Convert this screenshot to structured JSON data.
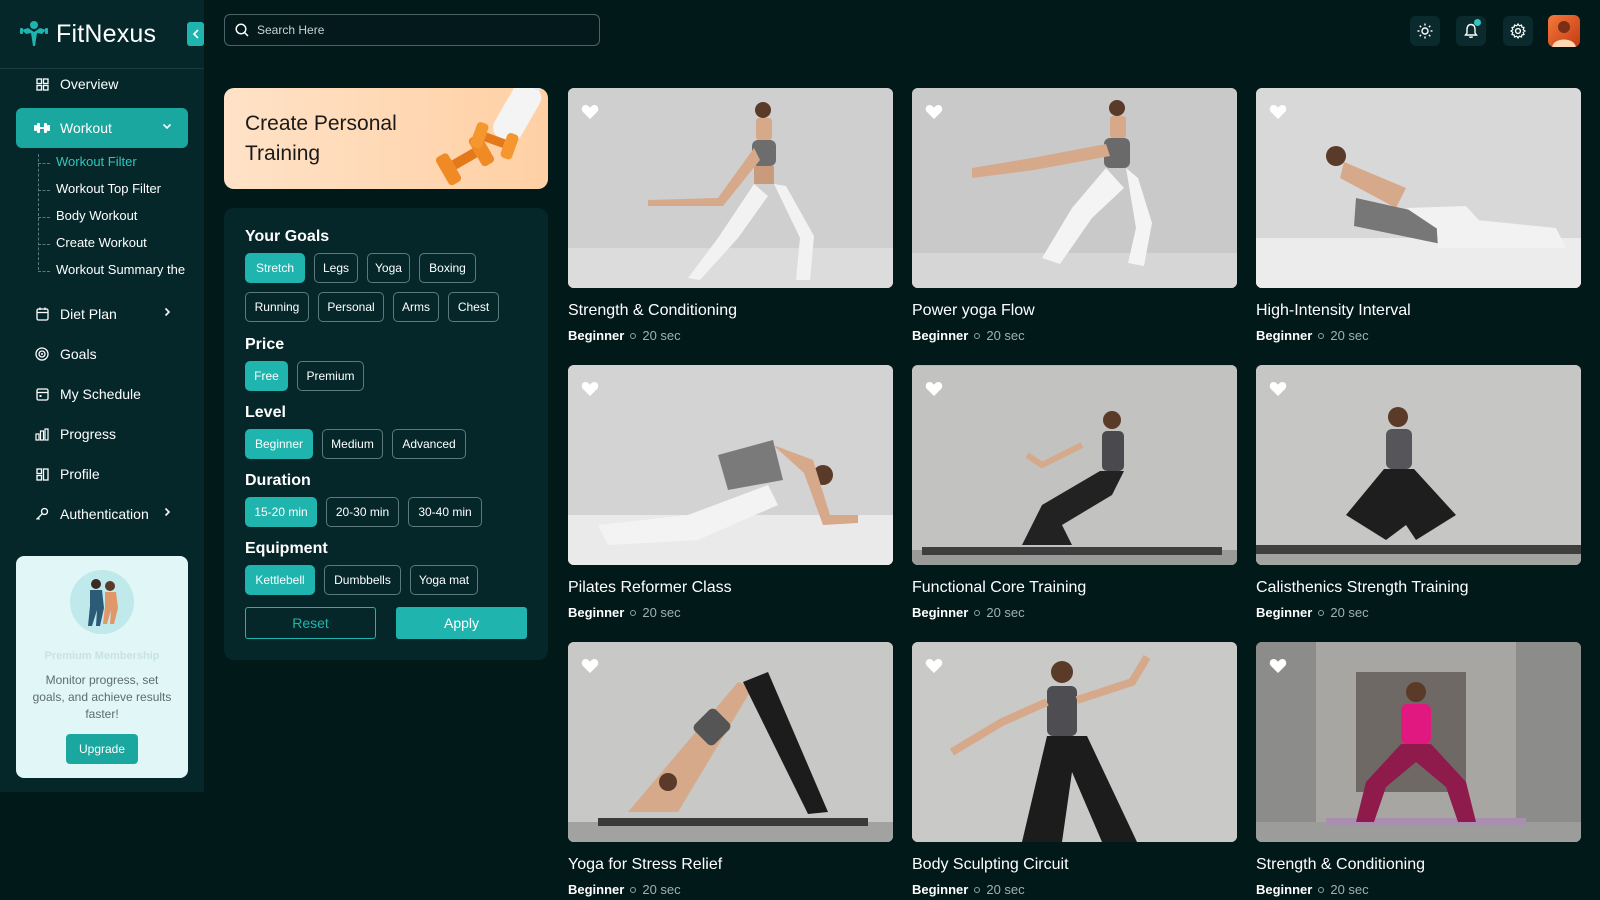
{
  "app": {
    "name": "FitNexus"
  },
  "search": {
    "placeholder": "Search Here"
  },
  "sidebar": {
    "items": [
      {
        "label": "Overview",
        "icon": "dashboard-icon"
      },
      {
        "label": "Workout",
        "icon": "dumbbell-icon",
        "active": true,
        "expanded": true
      },
      {
        "label": "Diet Plan",
        "icon": "calendar-icon"
      },
      {
        "label": "Goals",
        "icon": "target-icon"
      },
      {
        "label": "My Schedule",
        "icon": "schedule-icon"
      },
      {
        "label": "Progress",
        "icon": "bar-chart-icon"
      },
      {
        "label": "Profile",
        "icon": "profile-grid-icon"
      },
      {
        "label": "Authentication",
        "icon": "key-icon"
      }
    ],
    "submenu": [
      {
        "label": "Workout Filter",
        "active": true
      },
      {
        "label": "Workout Top Filter"
      },
      {
        "label": "Body Workout"
      },
      {
        "label": "Create Workout"
      },
      {
        "label": "Workout Summary"
      }
    ]
  },
  "promo": {
    "title": "Premium Membership",
    "text": "Monitor progress, set goals, and achieve results faster!",
    "button": "Upgrade"
  },
  "banner": {
    "title": "Create Personal Training"
  },
  "filters": {
    "goals": {
      "title": "Your Goals",
      "options": [
        "Stretch",
        "Legs",
        "Yoga",
        "Boxing",
        "Running",
        "Personal",
        "Arms",
        "Chest"
      ],
      "selected": "Stretch"
    },
    "price": {
      "title": "Price",
      "options": [
        "Free",
        "Premium"
      ],
      "selected": "Free"
    },
    "level": {
      "title": "Level",
      "options": [
        "Beginner",
        "Medium",
        "Advanced"
      ],
      "selected": "Beginner"
    },
    "duration": {
      "title": "Duration",
      "options": [
        "15-20 min",
        "20-30 min",
        "30-40 min"
      ],
      "selected": "15-20 min"
    },
    "equipment": {
      "title": "Equipment",
      "options": [
        "Kettlebell",
        "Dumbbells",
        "Yoga mat"
      ],
      "selected": "Kettlebell"
    },
    "reset": "Reset",
    "apply": "Apply"
  },
  "workouts": [
    {
      "title": "Strength & Conditioning",
      "level": "Beginner",
      "duration": "20 sec"
    },
    {
      "title": "Power yoga Flow",
      "level": "Beginner",
      "duration": "20 sec"
    },
    {
      "title": "High-Intensity Interval",
      "level": "Beginner",
      "duration": "20 sec"
    },
    {
      "title": "Pilates Reformer Class",
      "level": "Beginner",
      "duration": "20 sec"
    },
    {
      "title": "Functional Core Training",
      "level": "Beginner",
      "duration": "20 sec"
    },
    {
      "title": "Calisthenics Strength Training",
      "level": "Beginner",
      "duration": "20 sec"
    },
    {
      "title": "Yoga for Stress Relief",
      "level": "Beginner",
      "duration": "20 sec"
    },
    {
      "title": "Body Sculpting Circuit",
      "level": "Beginner",
      "duration": "20 sec"
    },
    {
      "title": "Strength & Conditioning",
      "level": "Beginner",
      "duration": "20 sec"
    }
  ],
  "colors": {
    "accent": "#1fb5ae",
    "background": "#02191a",
    "panel": "#06272a",
    "banner": "#ffd9b5"
  }
}
